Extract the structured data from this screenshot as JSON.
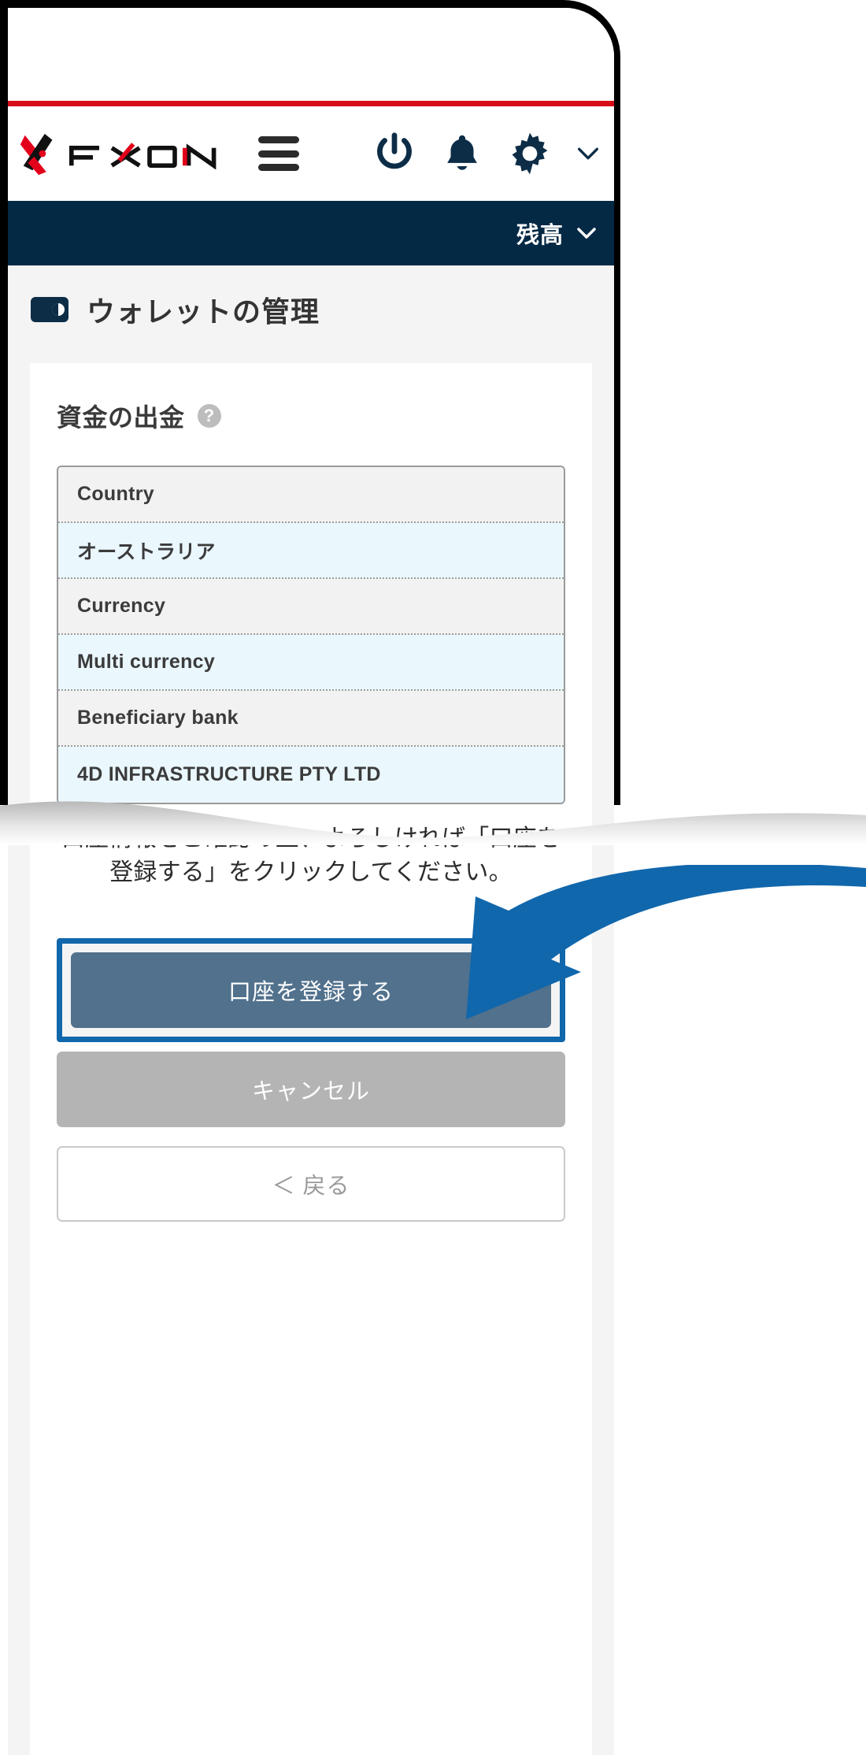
{
  "brand": {
    "name": "FXON",
    "logo_colors": {
      "red": "#e3001b",
      "black": "#111111"
    }
  },
  "header": {
    "menu_icon": "hamburger-icon",
    "icons": [
      {
        "name": "power-icon",
        "label": "ログアウト"
      },
      {
        "name": "bell-icon",
        "label": "通知"
      },
      {
        "name": "gear-icon",
        "label": "設定"
      },
      {
        "name": "chevron-down-icon",
        "label": "メニューを開く"
      }
    ],
    "accent_red": "#d80c18"
  },
  "balance_bar": {
    "label": "残高",
    "chevron": "chevron-down-icon",
    "background": "#042945"
  },
  "page": {
    "icon": "wallet-icon",
    "title": "ウォレットの管理"
  },
  "card": {
    "title": "資金の出金",
    "help_icon": "help-circle-icon",
    "help_glyph": "?"
  },
  "info_table": {
    "rows": [
      {
        "type": "label",
        "text": "Country"
      },
      {
        "type": "value",
        "text": "オーストラリア"
      },
      {
        "type": "label",
        "text": "Currency"
      },
      {
        "type": "value",
        "text": "Multi currency"
      },
      {
        "type": "label",
        "text": "Beneficiary bank"
      },
      {
        "type": "value",
        "text": "4D INFRASTRUCTURE PTY LTD"
      }
    ]
  },
  "confirm": {
    "text": "口座情報をご確認の上、よろしければ「口座を登録する」をクリックしてください。"
  },
  "buttons": {
    "primary": "口座を登録する",
    "cancel": "キャンセル",
    "back": "＜ 戻る"
  },
  "annotation": {
    "arrow_color": "#1167ac",
    "highlight_color": "#1167ac",
    "target": "口座を登録する"
  }
}
